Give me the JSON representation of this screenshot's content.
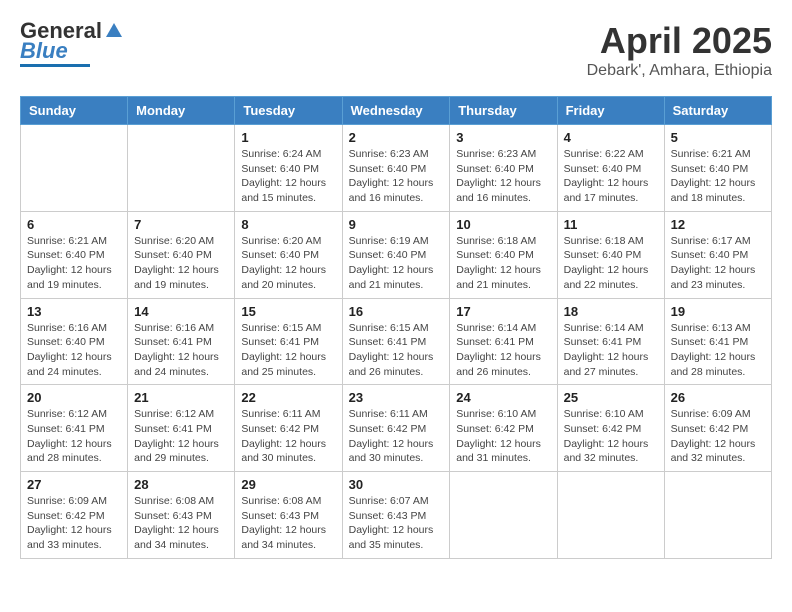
{
  "logo": {
    "line1": "General",
    "line2": "Blue"
  },
  "title": "April 2025",
  "subtitle": "Debark', Amhara, Ethiopia",
  "days_of_week": [
    "Sunday",
    "Monday",
    "Tuesday",
    "Wednesday",
    "Thursday",
    "Friday",
    "Saturday"
  ],
  "weeks": [
    [
      {
        "day": "",
        "info": ""
      },
      {
        "day": "",
        "info": ""
      },
      {
        "day": "1",
        "info": "Sunrise: 6:24 AM\nSunset: 6:40 PM\nDaylight: 12 hours and 15 minutes."
      },
      {
        "day": "2",
        "info": "Sunrise: 6:23 AM\nSunset: 6:40 PM\nDaylight: 12 hours and 16 minutes."
      },
      {
        "day": "3",
        "info": "Sunrise: 6:23 AM\nSunset: 6:40 PM\nDaylight: 12 hours and 16 minutes."
      },
      {
        "day": "4",
        "info": "Sunrise: 6:22 AM\nSunset: 6:40 PM\nDaylight: 12 hours and 17 minutes."
      },
      {
        "day": "5",
        "info": "Sunrise: 6:21 AM\nSunset: 6:40 PM\nDaylight: 12 hours and 18 minutes."
      }
    ],
    [
      {
        "day": "6",
        "info": "Sunrise: 6:21 AM\nSunset: 6:40 PM\nDaylight: 12 hours and 19 minutes."
      },
      {
        "day": "7",
        "info": "Sunrise: 6:20 AM\nSunset: 6:40 PM\nDaylight: 12 hours and 19 minutes."
      },
      {
        "day": "8",
        "info": "Sunrise: 6:20 AM\nSunset: 6:40 PM\nDaylight: 12 hours and 20 minutes."
      },
      {
        "day": "9",
        "info": "Sunrise: 6:19 AM\nSunset: 6:40 PM\nDaylight: 12 hours and 21 minutes."
      },
      {
        "day": "10",
        "info": "Sunrise: 6:18 AM\nSunset: 6:40 PM\nDaylight: 12 hours and 21 minutes."
      },
      {
        "day": "11",
        "info": "Sunrise: 6:18 AM\nSunset: 6:40 PM\nDaylight: 12 hours and 22 minutes."
      },
      {
        "day": "12",
        "info": "Sunrise: 6:17 AM\nSunset: 6:40 PM\nDaylight: 12 hours and 23 minutes."
      }
    ],
    [
      {
        "day": "13",
        "info": "Sunrise: 6:16 AM\nSunset: 6:40 PM\nDaylight: 12 hours and 24 minutes."
      },
      {
        "day": "14",
        "info": "Sunrise: 6:16 AM\nSunset: 6:41 PM\nDaylight: 12 hours and 24 minutes."
      },
      {
        "day": "15",
        "info": "Sunrise: 6:15 AM\nSunset: 6:41 PM\nDaylight: 12 hours and 25 minutes."
      },
      {
        "day": "16",
        "info": "Sunrise: 6:15 AM\nSunset: 6:41 PM\nDaylight: 12 hours and 26 minutes."
      },
      {
        "day": "17",
        "info": "Sunrise: 6:14 AM\nSunset: 6:41 PM\nDaylight: 12 hours and 26 minutes."
      },
      {
        "day": "18",
        "info": "Sunrise: 6:14 AM\nSunset: 6:41 PM\nDaylight: 12 hours and 27 minutes."
      },
      {
        "day": "19",
        "info": "Sunrise: 6:13 AM\nSunset: 6:41 PM\nDaylight: 12 hours and 28 minutes."
      }
    ],
    [
      {
        "day": "20",
        "info": "Sunrise: 6:12 AM\nSunset: 6:41 PM\nDaylight: 12 hours and 28 minutes."
      },
      {
        "day": "21",
        "info": "Sunrise: 6:12 AM\nSunset: 6:41 PM\nDaylight: 12 hours and 29 minutes."
      },
      {
        "day": "22",
        "info": "Sunrise: 6:11 AM\nSunset: 6:42 PM\nDaylight: 12 hours and 30 minutes."
      },
      {
        "day": "23",
        "info": "Sunrise: 6:11 AM\nSunset: 6:42 PM\nDaylight: 12 hours and 30 minutes."
      },
      {
        "day": "24",
        "info": "Sunrise: 6:10 AM\nSunset: 6:42 PM\nDaylight: 12 hours and 31 minutes."
      },
      {
        "day": "25",
        "info": "Sunrise: 6:10 AM\nSunset: 6:42 PM\nDaylight: 12 hours and 32 minutes."
      },
      {
        "day": "26",
        "info": "Sunrise: 6:09 AM\nSunset: 6:42 PM\nDaylight: 12 hours and 32 minutes."
      }
    ],
    [
      {
        "day": "27",
        "info": "Sunrise: 6:09 AM\nSunset: 6:42 PM\nDaylight: 12 hours and 33 minutes."
      },
      {
        "day": "28",
        "info": "Sunrise: 6:08 AM\nSunset: 6:43 PM\nDaylight: 12 hours and 34 minutes."
      },
      {
        "day": "29",
        "info": "Sunrise: 6:08 AM\nSunset: 6:43 PM\nDaylight: 12 hours and 34 minutes."
      },
      {
        "day": "30",
        "info": "Sunrise: 6:07 AM\nSunset: 6:43 PM\nDaylight: 12 hours and 35 minutes."
      },
      {
        "day": "",
        "info": ""
      },
      {
        "day": "",
        "info": ""
      },
      {
        "day": "",
        "info": ""
      }
    ]
  ]
}
